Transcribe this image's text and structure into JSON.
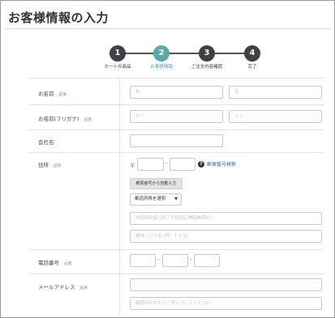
{
  "page": {
    "title": "お客様情報の入力"
  },
  "steps": [
    {
      "number": "1",
      "label": "カートの商品"
    },
    {
      "number": "2",
      "label": "お客様情報"
    },
    {
      "number": "3",
      "label": "ご注文内容確認"
    },
    {
      "number": "4",
      "label": "完了"
    }
  ],
  "active_step": 2,
  "required_label": "必須",
  "form": {
    "name": {
      "label": "お名前",
      "last_placeholder": "姓",
      "first_placeholder": "名"
    },
    "kana": {
      "label": "お名前(フリガナ)",
      "last_placeholder": "セイ",
      "first_placeholder": "メイ"
    },
    "company": {
      "label": "会社名"
    },
    "address": {
      "label": "住所",
      "postal_mark": "〒",
      "postal_help": "郵便番号検索",
      "auto_button": "郵便番号から自動入力",
      "prefecture_select": "都道府県を選択",
      "city_placeholder": "市区町村名 (例：千代田区神田神保町)",
      "street_placeholder": "番地・ビル名 (例：1-3-5)"
    },
    "phone": {
      "label": "電話番号"
    },
    "email": {
      "label": "メールアドレス",
      "confirm_placeholder": "確認のためもう一度入力してください"
    }
  }
}
